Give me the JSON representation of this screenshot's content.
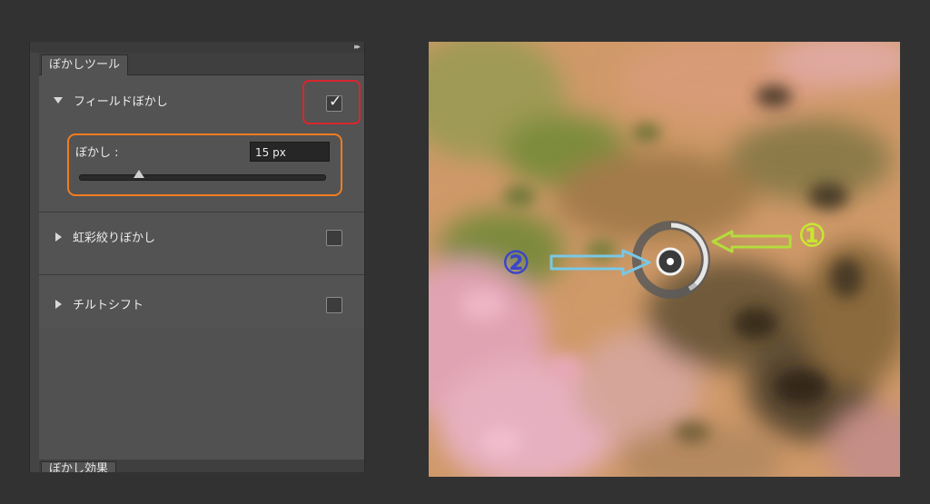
{
  "panel": {
    "tab_label": "ぼかしツール",
    "bottom_tab_label": "ぼかし効果",
    "sections": [
      {
        "label": "フィールドぼかし",
        "expanded": true,
        "checked": true
      },
      {
        "label": "虹彩絞りぼかし",
        "expanded": false,
        "checked": false
      },
      {
        "label": "チルトシフト",
        "expanded": false,
        "checked": false
      }
    ],
    "blur": {
      "label": "ぼかし :",
      "value": "15 px",
      "slider_fraction": 0.1
    }
  },
  "annotations": {
    "label_1": "①",
    "label_2": "②",
    "colors": {
      "arrow_1": "#b4dc3c",
      "arrow_2": "#78c8e6",
      "label_1": "#c8e632",
      "label_2": "#3c46c8",
      "highlight_checkbox": "#d8262f",
      "highlight_blur": "#ef7d22"
    }
  },
  "icons": [
    "collapse-panel-icon",
    "expand-triangle-icon",
    "checkbox-check-icon",
    "blur-pin-icon",
    "arrow-icon"
  ]
}
